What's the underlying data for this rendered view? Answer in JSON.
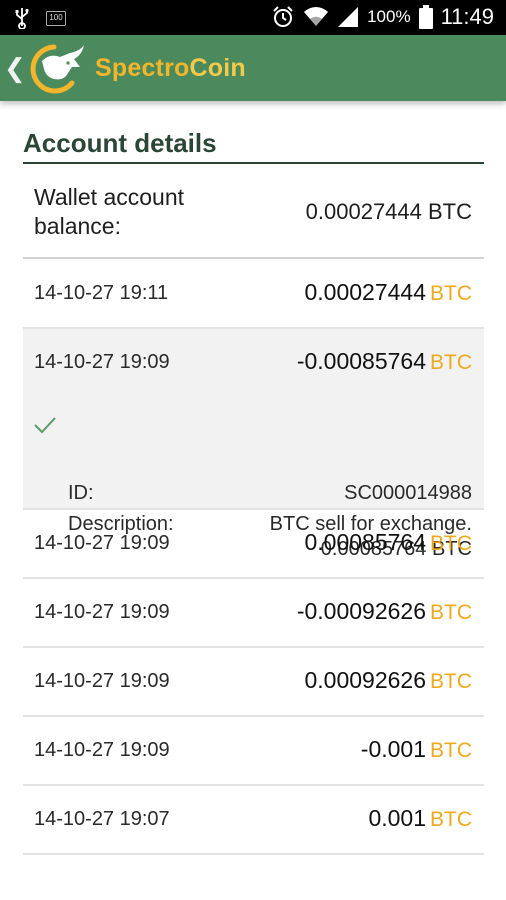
{
  "status_bar": {
    "battery_small": "100",
    "battery_percent": "100%",
    "time": "11:49"
  },
  "app_bar": {
    "brand_part1": "Spectro",
    "brand_part2": "Coin"
  },
  "account": {
    "title": "Account details",
    "balance_label": "Wallet account balance:",
    "balance_value": "0.00027444 BTC"
  },
  "transactions": [
    {
      "date": "14-10-27 19:11",
      "amount": "0.00027444",
      "currency": "BTC"
    },
    {
      "date": "14-10-27 19:09",
      "amount": "-0.00085764",
      "currency": "BTC",
      "details": {
        "id_label": "ID:",
        "id_value": "SC000014988",
        "description_label": "Description:",
        "description_line1": "BTC sell for exchange.",
        "description_line2": "0.00085764 BTC"
      }
    },
    {
      "date": "14-10-27 19:09",
      "amount": "0.00085764",
      "currency": "BTC"
    },
    {
      "date": "14-10-27 19:09",
      "amount": "-0.00092626",
      "currency": "BTC"
    },
    {
      "date": "14-10-27 19:09",
      "amount": "0.00092626",
      "currency": "BTC"
    },
    {
      "date": "14-10-27 19:09",
      "amount": "-0.001",
      "currency": "BTC"
    },
    {
      "date": "14-10-27 19:07",
      "amount": "0.001",
      "currency": "BTC"
    }
  ],
  "colors": {
    "app_bar": "#4b8a5c",
    "brand": "#f2b52b",
    "currency": "#f0a81c",
    "title": "#2c4636",
    "expanded_row": "#f2f2f2"
  },
  "icons": [
    "usb-icon",
    "battery-small-icon",
    "alarm-icon",
    "wifi-icon",
    "signal-icon",
    "battery-icon",
    "back-icon",
    "logo-icon",
    "check-icon"
  ]
}
